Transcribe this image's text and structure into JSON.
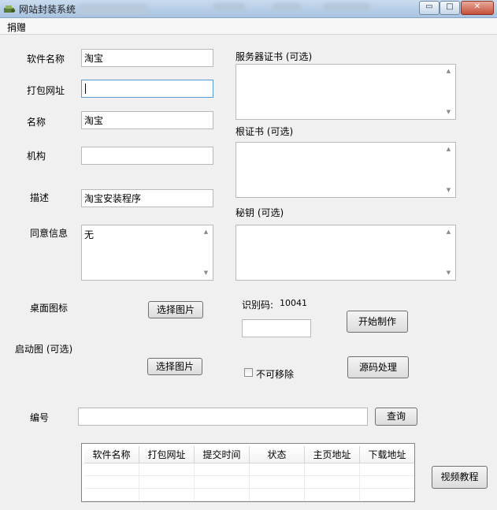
{
  "window": {
    "title": "网站封装系统",
    "controls": {
      "minimize": "▭",
      "maximize": "□",
      "close": "✕"
    }
  },
  "menu": {
    "items": [
      "捐赠"
    ]
  },
  "form": {
    "software_name": {
      "label": "软件名称",
      "value": "淘宝"
    },
    "package_url": {
      "label": "打包网址",
      "value": ""
    },
    "name": {
      "label": "名称",
      "value": "淘宝"
    },
    "organization": {
      "label": "机构",
      "value": ""
    },
    "description": {
      "label": "描述",
      "value": "淘宝安装程序"
    },
    "consent": {
      "label": "同意信息",
      "value": "无"
    },
    "desktop_icon": {
      "label": "桌面图标",
      "button": "选择图片"
    },
    "splash": {
      "label": "启动图 (可选)",
      "button": "选择图片"
    }
  },
  "right": {
    "server_cert": {
      "label": "服务器证书 (可选)"
    },
    "root_cert": {
      "label": "根证书 (可选)"
    },
    "secret_key": {
      "label": "秘钥 (可选)"
    },
    "id_code": {
      "label": "识别码:",
      "value": "10041",
      "input": ""
    },
    "start_button": "开始制作",
    "source_button": "源码处理",
    "not_removable": {
      "label": "不可移除",
      "checked": false
    }
  },
  "lookup": {
    "label": "编号",
    "value": "",
    "button": "查询"
  },
  "table": {
    "columns": [
      "软件名称",
      "打包网址",
      "提交时间",
      "状态",
      "主页地址",
      "下载地址"
    ],
    "rows": []
  },
  "video_button": "视频教程",
  "colors": {
    "titlebar": "#b8cde6",
    "focus": "#5b9bd5",
    "window": "#f0f0f0"
  }
}
